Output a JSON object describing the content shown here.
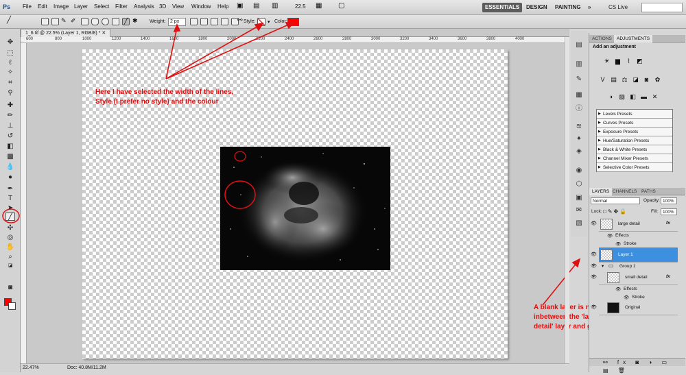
{
  "app": {
    "logo": "Ps",
    "menus": [
      "File",
      "Edit",
      "Image",
      "Layer",
      "Select",
      "Filter",
      "Analysis",
      "3D",
      "View",
      "Window",
      "Help"
    ],
    "zoom": "22.5",
    "workspaces": [
      "ESSENTIALS",
      "DESIGN",
      "PAINTING"
    ],
    "more": "»",
    "cs_live": "CS Live"
  },
  "options": {
    "weight_label": "Weight:",
    "weight_value": "2 px",
    "style_label": "Style:",
    "color_label": "Color:",
    "color": "#ff0000"
  },
  "document": {
    "tab_title": "1_6.tif @ 22.5% (Layer 1, RGB/8) *",
    "ruler_ticks": [
      "600",
      "800",
      "1000",
      "1200",
      "1400",
      "1600",
      "1800",
      "2000",
      "2200",
      "2400",
      "2600",
      "2800",
      "3000",
      "3200",
      "3400",
      "3600",
      "3800",
      "4000"
    ],
    "status_zoom": "22.47%",
    "status_doc": "Doc: 40.8M/11.2M"
  },
  "annotations": {
    "top_note_line1": "Here I have selected the width of the lines,",
    "top_note_line2": "Style (I prefer no style) and the colour",
    "side_note_line1": "A blank layer is now",
    "side_note_line2": "inbetween the 'large",
    "side_note_line3": "detail' layer and group one",
    "color": "#e01010"
  },
  "adjustments": {
    "tabs": [
      "ACTIONS",
      "ADJUSTMENTS"
    ],
    "title": "Add an adjustment",
    "presets": [
      "Levels Presets",
      "Curves Presets",
      "Exposure Presets",
      "Hue/Saturation Presets",
      "Black & White Presets",
      "Channel Mixer Presets",
      "Selective Color Presets"
    ]
  },
  "layers": {
    "tabs": [
      "LAYERS",
      "CHANNELS",
      "PATHS"
    ],
    "blend_mode": "Normal",
    "opacity_label": "Opacity:",
    "opacity_value": "100%",
    "lock_label": "Lock:",
    "fill_label": "Fill:",
    "fill_value": "100%",
    "items": [
      {
        "name": "large detail",
        "fx": "fx"
      },
      {
        "name": "Effects"
      },
      {
        "name": "Stroke"
      },
      {
        "name": "Layer 1",
        "selected": true
      },
      {
        "name": "Group 1"
      },
      {
        "name": "small detail",
        "fx": "fx"
      },
      {
        "name": "Effects"
      },
      {
        "name": "Stroke"
      },
      {
        "name": "Original"
      }
    ]
  }
}
